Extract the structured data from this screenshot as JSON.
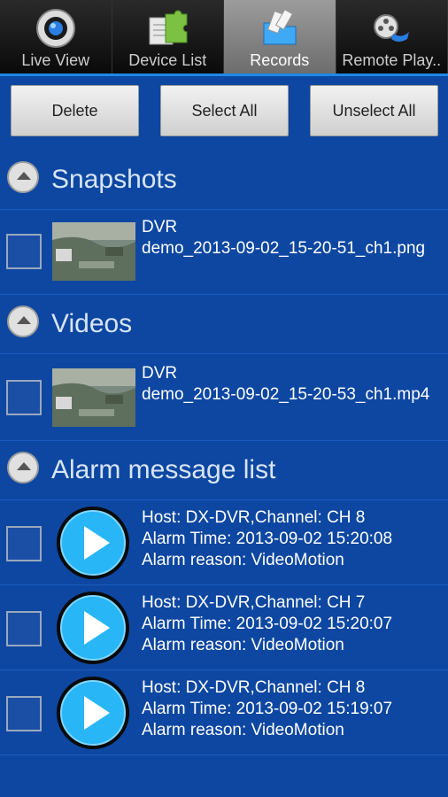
{
  "tabs": [
    {
      "label": "Live View",
      "icon": "camera-lens-icon"
    },
    {
      "label": "Device List",
      "icon": "puzzle-device-icon"
    },
    {
      "label": "Records",
      "icon": "folder-record-icon"
    },
    {
      "label": "Remote Play..",
      "icon": "film-reel-icon"
    }
  ],
  "actions": {
    "delete": "Delete",
    "select_all": "Select All",
    "unselect_all": "Unselect All"
  },
  "sections": {
    "snapshots": "Snapshots",
    "videos": "Videos",
    "alarms": "Alarm message list"
  },
  "snapshot_items": [
    {
      "line1": "DVR",
      "line2": "demo_2013-09-02_15-20-51_ch1.png"
    }
  ],
  "video_items": [
    {
      "line1": "DVR",
      "line2": "demo_2013-09-02_15-20-53_ch1.mp4"
    }
  ],
  "alarm_items": [
    {
      "host": "Host: DX-DVR,Channel: CH 8",
      "time": "Alarm Time: 2013-09-02 15:20:08",
      "reason": "Alarm reason: VideoMotion"
    },
    {
      "host": "Host: DX-DVR,Channel: CH 7",
      "time": "Alarm Time: 2013-09-02 15:20:07",
      "reason": "Alarm reason: VideoMotion"
    },
    {
      "host": "Host: DX-DVR,Channel: CH 8",
      "time": "Alarm Time: 2013-09-02 15:19:07",
      "reason": "Alarm reason: VideoMotion"
    }
  ],
  "colors": {
    "background": "#0d47a1",
    "accent": "#1e88e5",
    "play": "#29b6f6"
  }
}
